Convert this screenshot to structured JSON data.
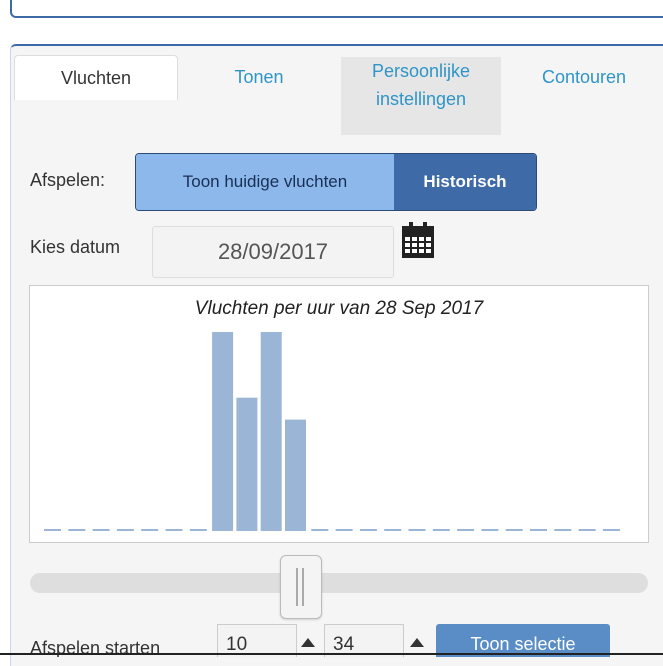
{
  "tabs": [
    {
      "label": "Vluchten"
    },
    {
      "label": "Tonen"
    },
    {
      "label": "Persoonlijke instellingen"
    },
    {
      "label": "Contouren"
    }
  ],
  "playback": {
    "label": "Afspelen:",
    "current_label": "Toon huidige vluchten",
    "historic_label": "Historisch"
  },
  "date": {
    "label": "Kies datum",
    "value": "28/09/2017"
  },
  "chart_data": {
    "type": "bar",
    "title": "Vluchten per uur van 28 Sep 2017",
    "xlabel": "",
    "ylabel": "",
    "values": [
      0,
      0,
      0,
      0,
      0,
      0,
      0,
      100,
      67,
      100,
      56,
      0,
      0,
      0,
      0,
      0,
      0,
      0,
      0,
      0,
      0,
      0,
      0,
      0
    ]
  },
  "slider": {
    "value_fraction": 0.44
  },
  "start": {
    "label": "Afspelen starten",
    "hour": "10",
    "minute": "34",
    "button_label": "Toon selectie"
  },
  "icons": {
    "calendar": "calendar-icon"
  }
}
